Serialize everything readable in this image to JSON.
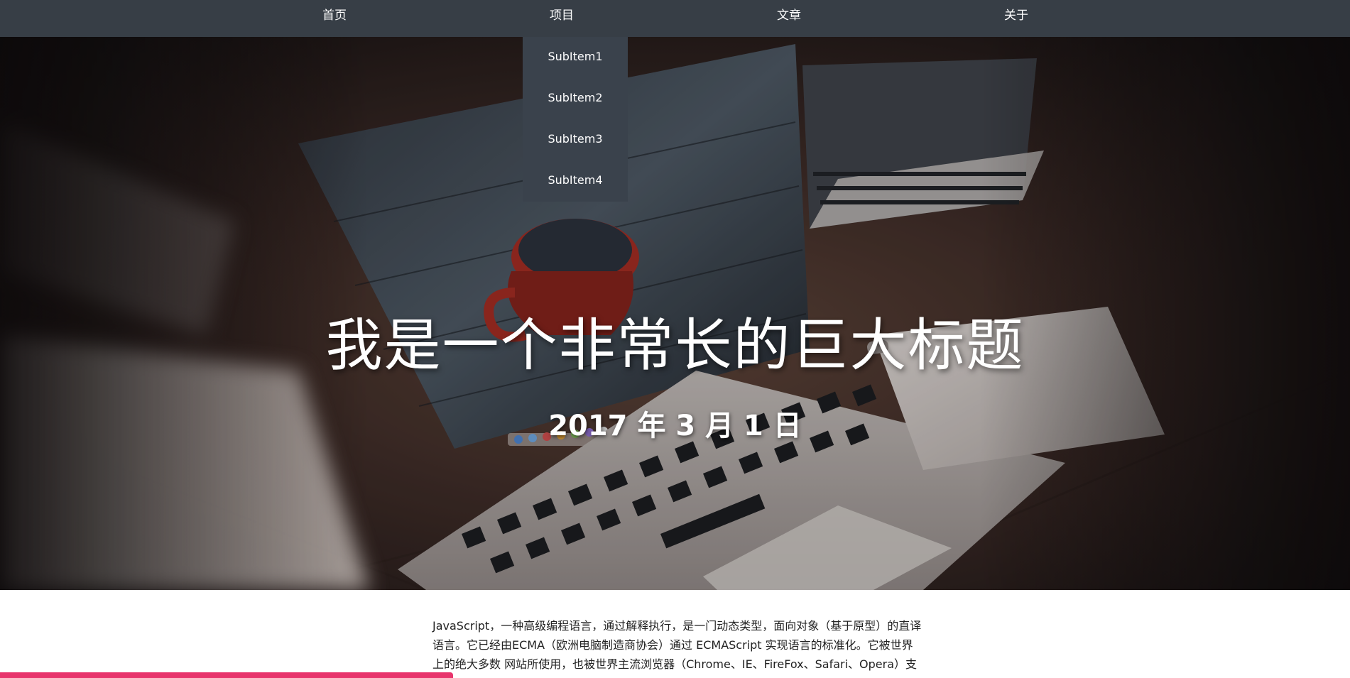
{
  "nav": {
    "items": [
      "首页",
      "项目",
      "文章",
      "关于"
    ]
  },
  "dropdown": {
    "items": [
      "SubItem1",
      "SubItem2",
      "SubItem3",
      "SubItem4"
    ]
  },
  "hero": {
    "title": "我是一个非常长的巨大标题",
    "date": "2017 年 3 月 1 日"
  },
  "article": {
    "text": "JavaScript，一种高级编程语言，通过解释执行，是一门动态类型，面向对象（基于原型）的直译语言。它已经由ECMA（欧洲电脑制造商协会）通过 ECMAScript 实现语言的标准化。它被世界上的绝大多数 网站所使用，也被世界主流浏览器（Chrome、IE、FireFox、Safari、Opera）支"
  },
  "colors": {
    "nav_bg": "#373e46",
    "dropdown_bg": "#3a424c",
    "accent_bar": "#e8346c"
  }
}
